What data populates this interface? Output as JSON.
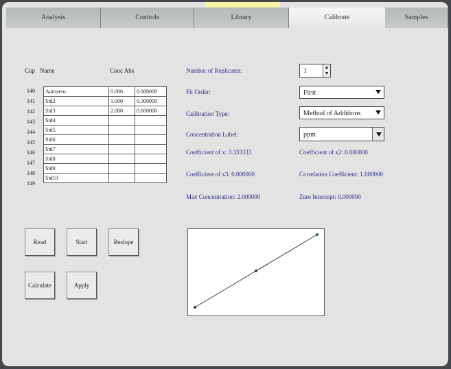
{
  "tabs": [
    {
      "label": "Analysis",
      "active": false
    },
    {
      "label": "Controls",
      "active": false
    },
    {
      "label": "Library",
      "active": false
    },
    {
      "label": "Calibrate",
      "active": true
    },
    {
      "label": "Samples",
      "active": false
    }
  ],
  "table": {
    "headers": {
      "cup": "Cup",
      "name": "Name",
      "conc_abs": "Conc Abs"
    },
    "rows": [
      {
        "cup": "140",
        "name": "Autozero",
        "conc": "0.000",
        "abs": "0.000000"
      },
      {
        "cup": "141",
        "name": "Std2",
        "conc": "1.000",
        "abs": "0.300000"
      },
      {
        "cup": "142",
        "name": "Std3",
        "conc": "2.000",
        "abs": "0.600000"
      },
      {
        "cup": "143",
        "name": "Std4",
        "conc": "",
        "abs": ""
      },
      {
        "cup": "144",
        "name": "Std5",
        "conc": "",
        "abs": ""
      },
      {
        "cup": "145",
        "name": "Std6",
        "conc": "",
        "abs": ""
      },
      {
        "cup": "146",
        "name": "Std7",
        "conc": "",
        "abs": ""
      },
      {
        "cup": "147",
        "name": "Std8",
        "conc": "",
        "abs": ""
      },
      {
        "cup": "148",
        "name": "Std9",
        "conc": "",
        "abs": ""
      },
      {
        "cup": "149",
        "name": "Std10",
        "conc": "",
        "abs": ""
      }
    ]
  },
  "settings": {
    "replicates_label": "Number of Replicates:",
    "replicates_value": "1",
    "fit_order_label": "Fit Order:",
    "fit_order_value": "First",
    "calibration_type_label": "Calibration Type:",
    "calibration_type_value": "Method of Additions",
    "concentration_label_label": "Concentration Label:",
    "concentration_label_value": "ppm"
  },
  "coefficients": {
    "coef_x": "Coefficient of x: 3.333333",
    "coef_x2": "Coefficient of x2: 0.000000",
    "coef_x3": "Coefficient of x3: 0.000000",
    "correlation": "Correlation Coefficient: 1.000000",
    "max_conc": "Max Concentration: 2.000000",
    "zero_intercept": "Zero Intercept: 0.000000"
  },
  "buttons": {
    "read": "Read",
    "start": "Start",
    "reslope": "Reslope",
    "calculate": "Calculate",
    "apply": "Apply"
  },
  "chart_data": {
    "type": "line",
    "x": [
      0,
      1,
      2
    ],
    "y": [
      0,
      0.3,
      0.6
    ],
    "xlim": [
      0,
      2
    ],
    "ylim": [
      0,
      0.6
    ],
    "grid": false
  }
}
